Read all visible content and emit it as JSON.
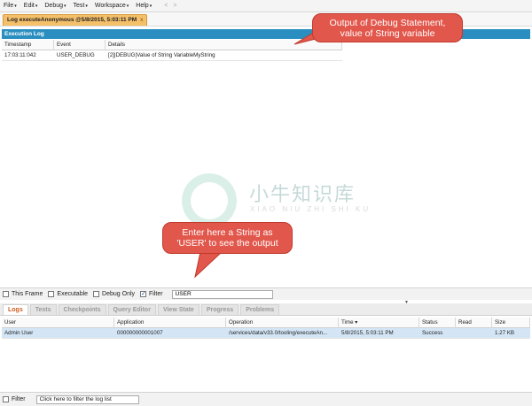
{
  "menubar": {
    "items": [
      {
        "label": "File"
      },
      {
        "label": "Edit"
      },
      {
        "label": "Debug"
      },
      {
        "label": "Test"
      },
      {
        "label": "Workspace"
      },
      {
        "label": "Help"
      }
    ],
    "back_icon": "<",
    "forward_icon": ">"
  },
  "tab": {
    "title": "Log executeAnonymous @5/8/2015, 5:03:11 PM",
    "close_glyph": "x"
  },
  "execution_log": {
    "header": "Execution Log",
    "columns": [
      "Timestamp",
      "Event",
      "Details"
    ],
    "rows": [
      {
        "timestamp": "17:03:11:042",
        "event": "USER_DEBUG",
        "details": "[2]|DEBUG|Value of String VariableMyString"
      }
    ]
  },
  "callouts": {
    "top": {
      "line1": "Output of Debug Statement,",
      "line2": "value of String variable"
    },
    "bottom": {
      "line1": "Enter here a String as",
      "line2": "'USER' to see the output"
    }
  },
  "watermark": {
    "chinese": "小牛知识库",
    "pinyin": "XIAO NIU ZHI SHI KU"
  },
  "filterbar": {
    "this_frame": {
      "label": "This Frame",
      "checked": false
    },
    "executable": {
      "label": "Executable",
      "checked": false
    },
    "debug_only": {
      "label": "Debug Only",
      "checked": false
    },
    "filter": {
      "label": "Filter",
      "checked": true
    },
    "filter_value": "USER"
  },
  "bottom_tabs": [
    {
      "label": "Logs",
      "active": true
    },
    {
      "label": "Tests",
      "active": false
    },
    {
      "label": "Checkpoints",
      "active": false
    },
    {
      "label": "Query Editor",
      "active": false
    },
    {
      "label": "View State",
      "active": false
    },
    {
      "label": "Progress",
      "active": false
    },
    {
      "label": "Problems",
      "active": false
    }
  ],
  "logs_table": {
    "columns": {
      "user": "User",
      "application": "Application",
      "operation": "Operation",
      "time": "Time",
      "time_sort_icon": "▾",
      "status": "Status",
      "read": "Read",
      "size": "Size"
    },
    "rows": [
      {
        "user": "Admin User",
        "application": "000000000001007",
        "operation": "/services/data/v33.0/tooling/executeAn...",
        "time": "5/8/2015, 5:03:11 PM",
        "status": "Success",
        "read": "",
        "size": "1.27 KB"
      }
    ]
  },
  "bottombar": {
    "filter_label": "Filter",
    "filter_checked": false,
    "filter_placeholder": "Click here to filter the log list"
  },
  "colors": {
    "accent_blue": "#2a8fc0",
    "callout_red": "#e2574c",
    "tab_orange": "#f5c06a",
    "active_tab_text": "#d35b1c",
    "selected_row": "#d4e6f6"
  }
}
